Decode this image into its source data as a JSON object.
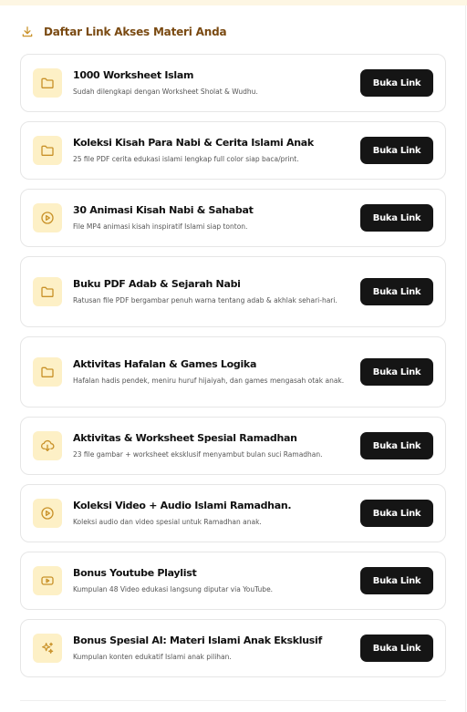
{
  "header": {
    "title": "Daftar Link Akses Materi Anda",
    "icon": "download-icon",
    "color": "#7a4a12"
  },
  "accent": {
    "icon_bg": "#fdf0c6",
    "icon_stroke": "#c9922a",
    "button_bg": "#151515"
  },
  "items": [
    {
      "icon": "folder-icon",
      "title": "1000 Worksheet Islam",
      "desc": "Sudah dilengkapi dengan Worksheet Sholat & Wudhu.",
      "button": "Buka Link"
    },
    {
      "icon": "folder-icon",
      "title": "Koleksi Kisah Para Nabi & Cerita Islami Anak",
      "desc": "25 file PDF cerita edukasi islami lengkap full color siap baca/print.",
      "button": "Buka Link"
    },
    {
      "icon": "play-circle-icon",
      "title": "30 Animasi Kisah Nabi & Sahabat",
      "desc": "File MP4 animasi kisah inspiratif Islami siap tonton.",
      "button": "Buka Link"
    },
    {
      "icon": "folder-icon",
      "title": "Buku PDF Adab & Sejarah Nabi",
      "desc": "Ratusan file PDF bergambar penuh warna tentang adab & akhlak sehari-hari.",
      "button": "Buka Link"
    },
    {
      "icon": "folder-icon",
      "title": "Aktivitas Hafalan & Games Logika",
      "desc": "Hafalan hadis pendek, meniru huruf hijaiyah, dan games mengasah otak anak.",
      "button": "Buka Link"
    },
    {
      "icon": "cloud-download-icon",
      "title": "Aktivitas & Worksheet Spesial Ramadhan",
      "desc": "23 file gambar + worksheet eksklusif menyambut bulan suci Ramadhan.",
      "button": "Buka Link"
    },
    {
      "icon": "play-circle-icon",
      "title": "Koleksi Video + Audio Islami Ramadhan.",
      "desc": "Koleksi audio dan video spesial untuk Ramadhan anak.",
      "button": "Buka Link"
    },
    {
      "icon": "youtube-icon",
      "title": "Bonus Youtube Playlist",
      "desc": "Kumpulan 48 Video edukasi langsung diputar via YouTube.",
      "button": "Buka Link"
    },
    {
      "icon": "sparkles-icon",
      "title": "Bonus Spesial AI: Materi Islami Anak Eksklusif",
      "desc": "Kumpulan konten edukatif Islami anak pilihan.",
      "button": "Buka Link"
    }
  ]
}
